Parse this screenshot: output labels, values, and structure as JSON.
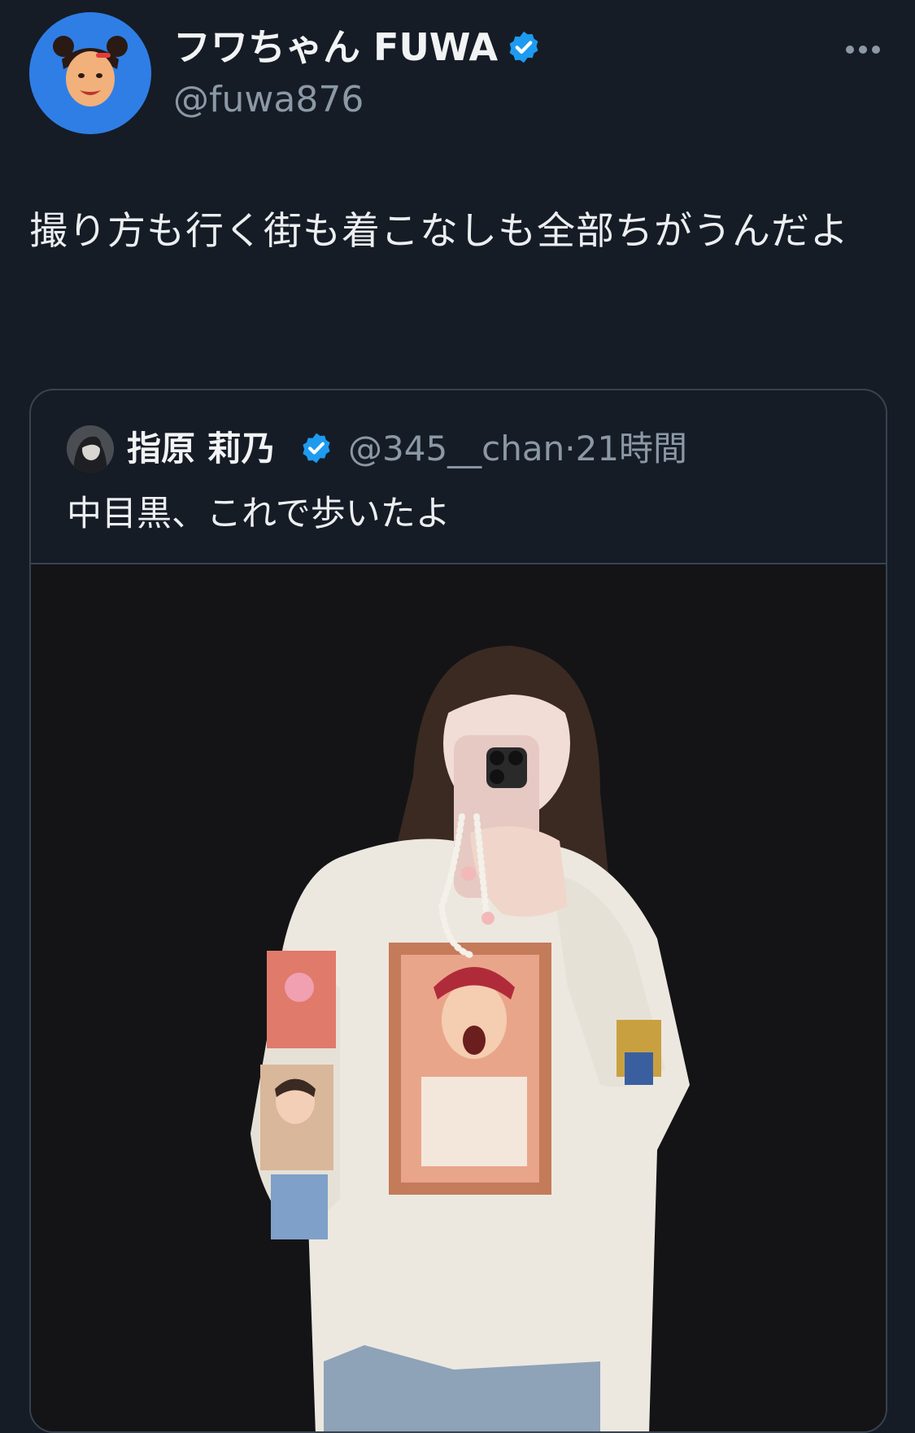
{
  "post": {
    "author_name": "フワちゃん FUWA",
    "author_handle": "@fuwa876",
    "text": "撮り方も行く街も着こなしも全部ちがうんだよ",
    "more_icon": "more-horizontal-icon",
    "verified_icon": "verified-badge-icon"
  },
  "quote": {
    "author_name": "指原 莉乃",
    "author_handle": "@345__chan",
    "separator": "·",
    "time": "21時間",
    "text": "中目黒、これで歩いたよ",
    "verified_icon": "verified-badge-icon",
    "photo_icon": "mirror-selfie-photo"
  },
  "colors": {
    "background": "#151c26",
    "avatar_bg": "#2f7ee6",
    "verified": "#1d9bf0",
    "secondary_text": "#8b98a5",
    "border": "#38434f",
    "photo_bg": "#141416"
  }
}
